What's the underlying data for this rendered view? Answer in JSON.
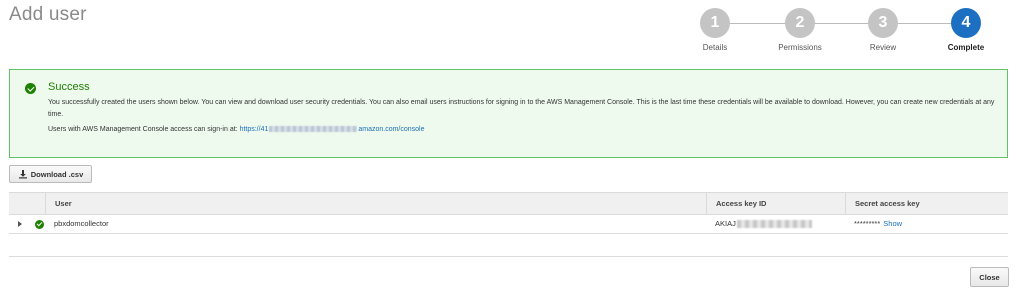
{
  "page": {
    "title": "Add user"
  },
  "stepper": {
    "steps": [
      {
        "number": "1",
        "label": "Details"
      },
      {
        "number": "2",
        "label": "Permissions"
      },
      {
        "number": "3",
        "label": "Review"
      },
      {
        "number": "4",
        "label": "Complete"
      }
    ],
    "active_step": 4,
    "colors": {
      "active": "#1d70c1",
      "inactive": "#c4c4c4"
    }
  },
  "alert": {
    "title": "Success",
    "body": "You successfully created the users shown below. You can view and download user security credentials. You can also email users instructions for signing in to the AWS Management Console. This is the last time these credentials will be available to download. However, you can create new credentials at any time.",
    "signin_text": "Users with AWS Management Console access can sign-in at:",
    "signin_link_prefix": "https://41",
    "signin_link_suffix": "amazon.com/console",
    "icon": "check-circle-icon",
    "colors": {
      "border": "#65c165",
      "background": "#effaef",
      "accent": "#1d8102"
    }
  },
  "toolbar": {
    "download_label": "Download .csv",
    "download_icon": "download-icon"
  },
  "table": {
    "columns": [
      "",
      "User",
      "Access key ID",
      "Secret access key"
    ],
    "rows": [
      {
        "user": "pbxdomcollector",
        "access_key_prefix": "AKIAJ",
        "secret_mask": "*********",
        "show_label": "Show",
        "status_icon": "check-circle-icon"
      }
    ]
  },
  "footer": {
    "close_label": "Close"
  },
  "colors": {
    "link": "#1a6fb8"
  }
}
